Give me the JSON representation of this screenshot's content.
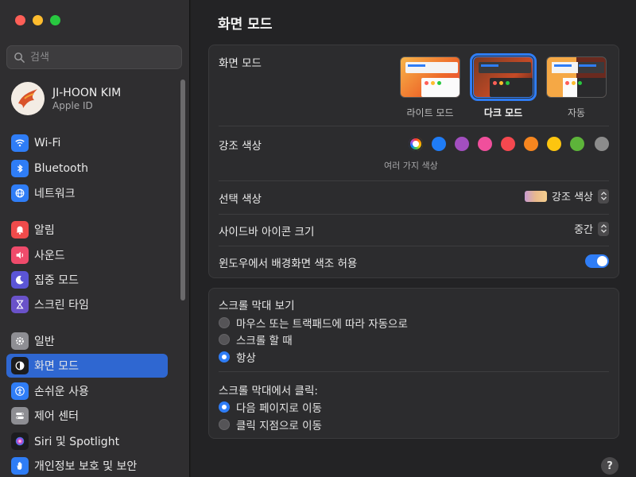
{
  "window": {
    "title": "화면 모드"
  },
  "search": {
    "placeholder": "검색"
  },
  "profile": {
    "name": "JI-HOON KIM",
    "subtitle": "Apple ID"
  },
  "sidebar": {
    "items": [
      {
        "label": "Wi-Fi",
        "icon": "wifi-icon",
        "color": "#2f7df6"
      },
      {
        "label": "Bluetooth",
        "icon": "bluetooth-icon",
        "color": "#2f7df6"
      },
      {
        "label": "네트워크",
        "icon": "globe-icon",
        "color": "#2f7df6"
      },
      {
        "label": "알림",
        "icon": "bell-icon",
        "color": "#ef4b4b"
      },
      {
        "label": "사운드",
        "icon": "speaker-icon",
        "color": "#ef4b6b"
      },
      {
        "label": "집중 모드",
        "icon": "moon-icon",
        "color": "#5b55d6"
      },
      {
        "label": "스크린 타임",
        "icon": "hourglass-icon",
        "color": "#6a52c9"
      },
      {
        "label": "일반",
        "icon": "gear-icon",
        "color": "#8e8e93"
      },
      {
        "label": "화면 모드",
        "icon": "appearance-icon",
        "color": "#1c1c1e",
        "selected": true
      },
      {
        "label": "손쉬운 사용",
        "icon": "accessibility-icon",
        "color": "#2f7df6"
      },
      {
        "label": "제어 센터",
        "icon": "control-center-icon",
        "color": "#8e8e93"
      },
      {
        "label": "Siri 및 Spotlight",
        "icon": "siri-icon",
        "color": "#1c1c1e"
      },
      {
        "label": "개인정보 보호 및 보안",
        "icon": "hand-icon",
        "color": "#2f7df6"
      }
    ]
  },
  "appearance": {
    "label": "화면 모드",
    "options": [
      {
        "label": "라이트 모드",
        "selected": false
      },
      {
        "label": "다크 모드",
        "selected": true
      },
      {
        "label": "자동",
        "selected": false
      }
    ]
  },
  "accent": {
    "label": "강조 색상",
    "caption": "여러 가지 색상",
    "colors": [
      "#multicolor",
      "#1f7cf6",
      "#a34fc0",
      "#f04f9c",
      "#f5484f",
      "#f7861f",
      "#fdc50f",
      "#5db43a",
      "#8c8c8c"
    ]
  },
  "highlight": {
    "label": "선택 색상",
    "value": "강조 색상"
  },
  "sidebar_icon_size": {
    "label": "사이드바 아이콘 크기",
    "value": "중간"
  },
  "wallpaper_tint": {
    "label": "윈도우에서 배경화면 색조 허용",
    "enabled": true
  },
  "scrollbars": {
    "label": "스크롤 막대 보기",
    "options": [
      {
        "label": "마우스 또는 트랙패드에 따라 자동으로",
        "selected": false
      },
      {
        "label": "스크롤 할 때",
        "selected": false
      },
      {
        "label": "항상",
        "selected": true
      }
    ]
  },
  "scroll_click": {
    "label": "스크롤 막대에서 클릭:",
    "options": [
      {
        "label": "다음 페이지로 이동",
        "selected": true
      },
      {
        "label": "클릭 지점으로 이동",
        "selected": false
      }
    ]
  },
  "help": {
    "label": "?"
  }
}
